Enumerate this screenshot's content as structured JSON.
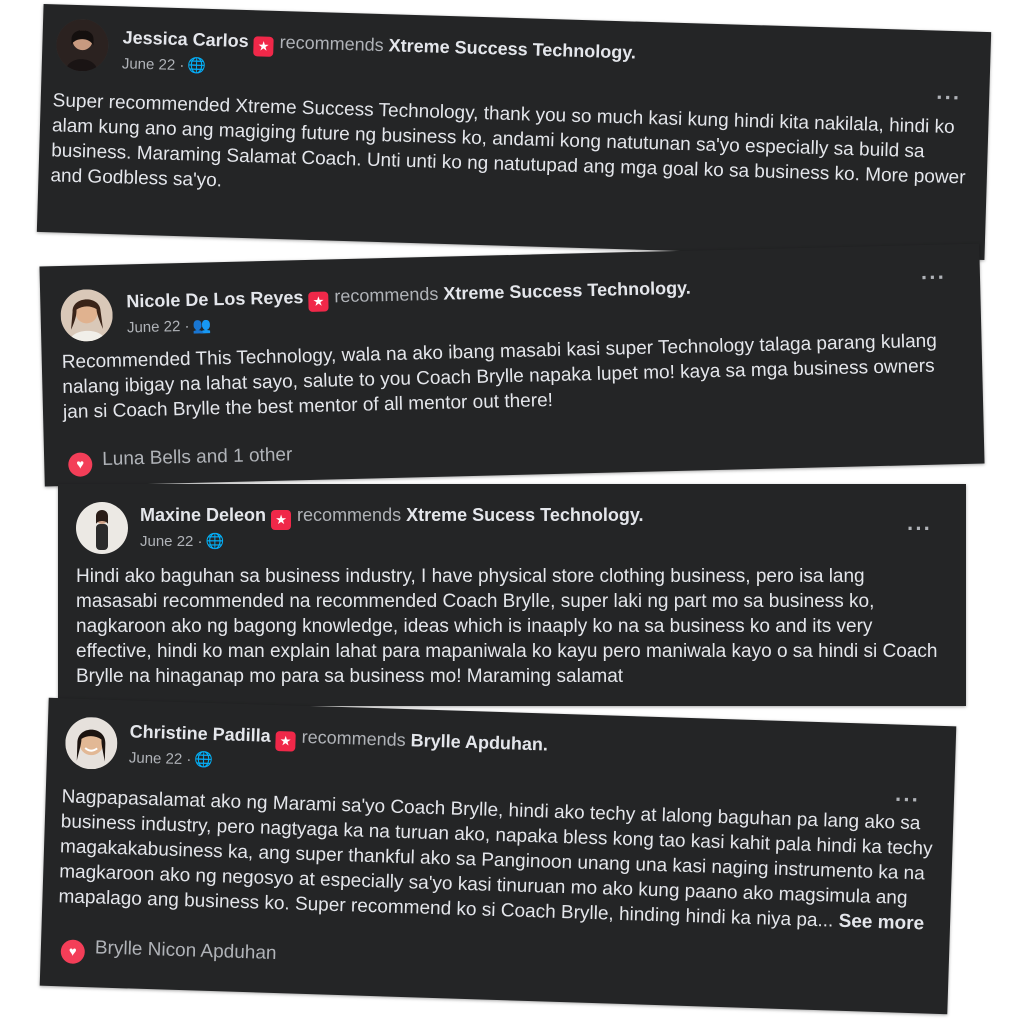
{
  "posts": [
    {
      "author": "Jessica Carlos",
      "action": "recommends",
      "target": "Xtreme Success Technology",
      "date": "June 22 ·",
      "audience_icon": "globe-icon",
      "text": "Super recommended Xtreme Success Technology, thank you so much kasi kung hindi kita nakilala, hindi ko alam kung ano ang magiging future ng business ko, andami kong natutunan sa'yo especially sa build sa business. Maraming Salamat Coach. Unti unti ko ng natutupad ang mga goal ko sa business ko. More power and Godbless sa'yo.",
      "see_more": "",
      "reactions": ""
    },
    {
      "author": "Nicole De Los Reyes",
      "action": "recommends",
      "target": "Xtreme Success Technology",
      "date": "June 22 ·",
      "audience_icon": "friends-icon",
      "text": "Recommended This Technology, wala na ako ibang masabi kasi super Technology talaga parang kulang nalang ibigay na lahat sayo, salute to you Coach Brylle napaka lupet mo! kaya sa mga business owners jan si Coach Brylle the best mentor of all mentor out there!",
      "see_more": "",
      "reactions": "Luna Bells and 1 other"
    },
    {
      "author": "Maxine Deleon",
      "action": "recommends",
      "target": "Xtreme Sucess Technology",
      "date": "June 22 ·",
      "audience_icon": "globe-icon",
      "text": "Hindi ako baguhan sa business industry, I have physical store clothing business, pero isa lang masasabi recommended na recommended Coach Brylle, super laki ng part mo sa business ko, nagkaroon ako ng bagong knowledge, ideas which is inaaply ko na sa business ko and its very effective, hindi ko man explain lahat para mapaniwala ko kayu pero maniwala kayo o sa hindi si Coach Brylle na hinaganap mo para sa business mo! Maraming salamat",
      "see_more": "",
      "reactions": ""
    },
    {
      "author": "Christine Padilla",
      "action": "recommends",
      "target": "Brylle Apduhan",
      "date": "June 22 ·",
      "audience_icon": "globe-icon",
      "text": "Nagpapasalamat ako ng Marami sa'yo Coach Brylle, hindi ako techy at lalong baguhan pa lang ako sa business industry, pero nagtyaga ka na turuan ako, napaka bless kong tao kasi kahit pala hindi ka techy magakakabusiness ka, ang super thankful ako sa Panginoon unang una kasi naging instrumento ka na magkaroon ako ng negosyo at especially sa'yo kasi tinuruan mo ako kung paano ako magsimula ang mapalago ang business ko. Super recommend ko si Coach Brylle, hinding hindi ka niya pa...",
      "see_more": "See more",
      "reactions": "Brylle Nicon Apduhan"
    }
  ],
  "colors": {
    "card_bg": "#242526",
    "primary_text": "#e4e6eb",
    "secondary_text": "#b0b3b8",
    "badge": "#f02849",
    "love_reaction": "#f33e58"
  }
}
